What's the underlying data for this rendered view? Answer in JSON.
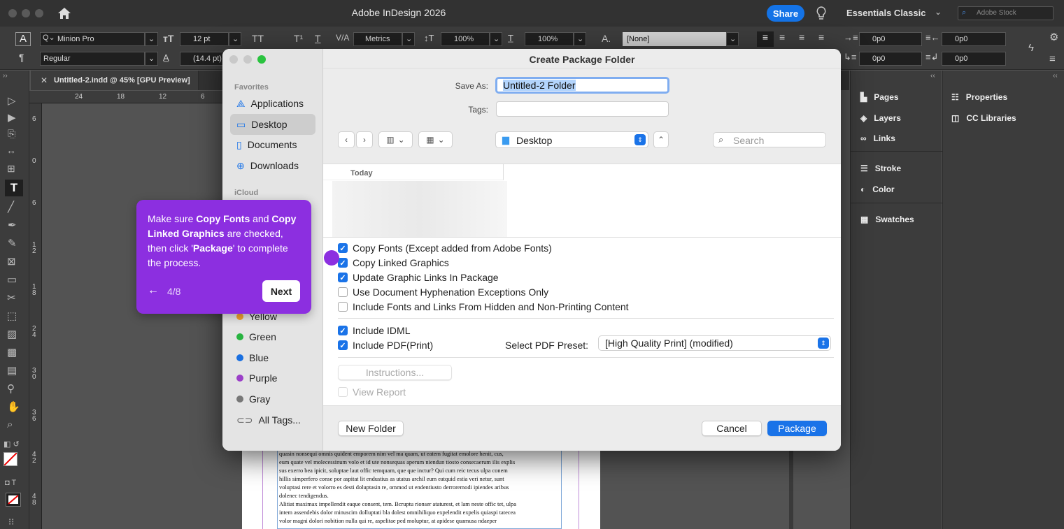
{
  "app": {
    "title": "Adobe InDesign 2026",
    "share_label": "Share",
    "workspace": "Essentials Classic",
    "search_placeholder": "Adobe Stock"
  },
  "control_bar": {
    "font_family": "Minion Pro",
    "font_style": "Regular",
    "font_size": "12 pt",
    "leading": "(14.4 pt)",
    "kerning": "Metrics",
    "vertical_scale": "100%",
    "horizontal_scale": "100%",
    "char_style": "[None]",
    "indent_left": "0p0",
    "indent_right": "0p0",
    "indent_first": "0p0",
    "indent_last": "0p0"
  },
  "document_tab": {
    "label": "Untitled-2.indd @ 45% [GPU Preview]"
  },
  "ruler": {
    "h_ticks": [
      "24",
      "18",
      "12",
      "6"
    ],
    "v_ticks": [
      "6",
      "0",
      "6",
      "1\n2",
      "1\n8",
      "2\n4",
      "3\n0",
      "3\n6",
      "4\n2",
      "4\n8"
    ]
  },
  "panels": {
    "left_column": [
      "Pages",
      "Layers",
      "Links",
      "Stroke",
      "Color",
      "Swatches"
    ],
    "right_column": [
      "Properties",
      "CC Libraries"
    ]
  },
  "dialog": {
    "title": "Create Package Folder",
    "save_as_label": "Save As:",
    "save_as_value": "Untitled-2 Folder",
    "tags_label": "Tags:",
    "location": "Desktop",
    "search_placeholder": "Search",
    "list_header": "Today",
    "sidebar": {
      "favorites_label": "Favorites",
      "favorites": [
        "Applications",
        "Desktop",
        "Documents",
        "Downloads"
      ],
      "icloud_label": "iCloud",
      "tags": [
        {
          "label": "Yellow",
          "color": "#f0a030"
        },
        {
          "label": "Green",
          "color": "#28b440"
        },
        {
          "label": "Blue",
          "color": "#1a6fe0"
        },
        {
          "label": "Purple",
          "color": "#9b3fc8"
        },
        {
          "label": "Gray",
          "color": "#777777"
        }
      ],
      "all_tags": "All Tags..."
    },
    "options": [
      {
        "label": "Copy Fonts (Except added from Adobe Fonts)",
        "checked": true
      },
      {
        "label": "Copy Linked Graphics",
        "checked": true
      },
      {
        "label": "Update Graphic Links In Package",
        "checked": true
      },
      {
        "label": "Use Document Hyphenation Exceptions Only",
        "checked": false
      },
      {
        "label": "Include Fonts and Links From Hidden and Non-Printing Content",
        "checked": false
      }
    ],
    "include_idml": {
      "label": "Include IDML",
      "checked": true
    },
    "include_pdf": {
      "label": "Include PDF(Print)",
      "checked": true
    },
    "pdf_preset_label": "Select PDF Preset:",
    "pdf_preset_value": "[High Quality Print] (modified)",
    "instructions_label": "Instructions...",
    "view_report_label": "View Report",
    "new_folder_label": "New Folder",
    "cancel_label": "Cancel",
    "package_label": "Package"
  },
  "tooltip": {
    "t1": "Make sure ",
    "b1": "Copy Fonts",
    "t2": " and ",
    "b2": "Copy Linked Graphics",
    "t3": " are checked, then click '",
    "b3": "Package",
    "t4": "' to complete the process.",
    "step": "4/8",
    "next_label": "Next"
  },
  "document_text": [
    "quasin nonsequi omnis quident emporem nim vel ma quam, ut eatem fugitat emolore henit, cus,",
    "eum quate vel molecessinum volo et id ute nonsequas aperum niendun tiosto consecaerum ilis explis",
    "sus exerro bea ipicit, soluptae laut offic temquam, que que inctur? Qui cum reic tecus ulpa conem",
    "hillis simperfero conse por aspitat lit endustius as utatus archil eum eatquid estia veri netur, sunt",
    "voluptasi rere et volorro es desti doluptasin re, ommod ut endentiusto derroremodi ipiendes aribus",
    "dolenec tendigendus.",
    "Alitiat maximax impellendit eaque consent, tem. Bcruptu rionser ataturest, et lam neste offic tet, ulpa",
    "intem assendebis dolor minuscim dolluptati bla dolest omnihiliquo expelendit expelis quiaspi tatecea",
    "volor magni dolori nobition nulla qui re, aspelitae ped moluptur, at apidese quamusa ndaeper"
  ]
}
